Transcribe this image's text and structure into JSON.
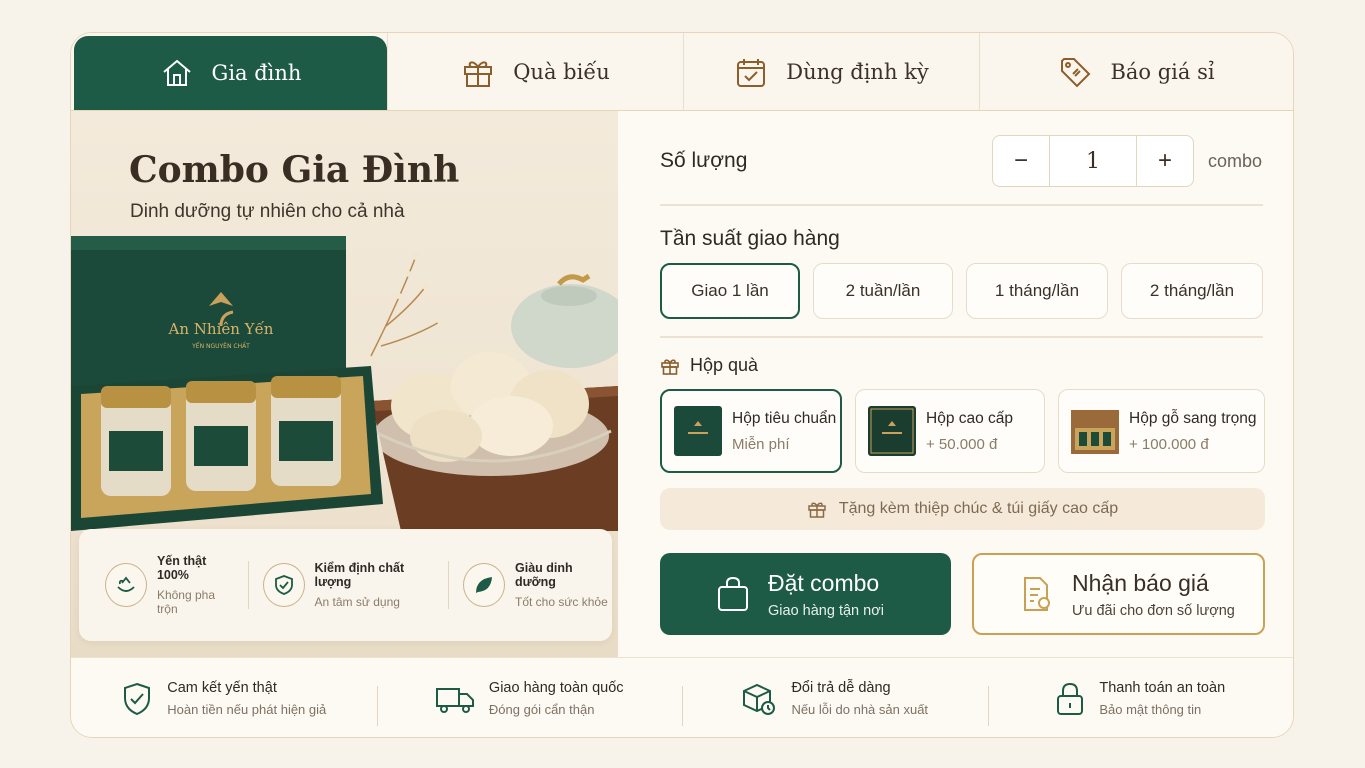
{
  "tabs": [
    {
      "label": "Gia đình",
      "icon": "home-icon",
      "active": true
    },
    {
      "label": "Quà biếu",
      "icon": "gift-icon",
      "active": false
    },
    {
      "label": "Dùng định kỳ",
      "icon": "calendar-icon",
      "active": false
    },
    {
      "label": "Báo giá sỉ",
      "icon": "price-tag-icon",
      "active": false
    }
  ],
  "hero": {
    "title": "Combo Gia Đình",
    "subtitle": "Dinh dưỡng tự nhiên cho cả nhà",
    "brand": "An Nhiên Yến",
    "brand_sub": "YẾN NGUYÊN CHẤT"
  },
  "features": [
    {
      "title": "Yến thật 100%",
      "desc": "Không pha trộn",
      "icon": "bird-nest-icon"
    },
    {
      "title": "Kiểm định chất lượng",
      "desc": "An tâm sử dụng",
      "icon": "shield-check-icon"
    },
    {
      "title": "Giàu dinh dưỡng",
      "desc": "Tốt cho sức khỏe",
      "icon": "leaf-icon"
    }
  ],
  "quantity": {
    "label": "Số lượng",
    "value": "1",
    "unit": "combo",
    "minus": "−",
    "plus": "+"
  },
  "frequency": {
    "label": "Tần suất giao hàng",
    "options": [
      "Giao 1 lần",
      "2 tuần/lần",
      "1 tháng/lần",
      "2 tháng/lần"
    ],
    "selected": "Giao 1 lần"
  },
  "gift_box": {
    "label": "Hộp quà",
    "options": [
      {
        "name": "Hộp tiêu chuẩn",
        "price": "Miễn phí"
      },
      {
        "name": "Hộp cao cấp",
        "price": "+ 50.000 đ"
      },
      {
        "name": "Hộp gỗ sang trọng",
        "price": "+ 100.000 đ"
      }
    ],
    "selected": "Hộp tiêu chuẩn",
    "note": "Tặng kèm thiệp chúc & túi giấy cao cấp"
  },
  "actions": {
    "order": {
      "title": "Đặt combo",
      "subtitle": "Giao hàng tận nơi"
    },
    "quote": {
      "title": "Nhận báo giá",
      "subtitle": "Ưu đãi cho đơn số lượng"
    }
  },
  "trust": [
    {
      "title": "Cam kết yến thật",
      "desc": "Hoàn tiền nếu phát hiện giả",
      "icon": "shield-check-icon"
    },
    {
      "title": "Giao hàng toàn quốc",
      "desc": "Đóng gói cẩn thận",
      "icon": "truck-icon"
    },
    {
      "title": "Đổi trả dễ dàng",
      "desc": "Nếu lỗi do nhà sản xuất",
      "icon": "box-return-icon"
    },
    {
      "title": "Thanh toán an toàn",
      "desc": "Bảo mật thông tin",
      "icon": "lock-icon"
    }
  ],
  "colors": {
    "primary": "#1d5b46",
    "accent": "#c9a155",
    "background": "#f8f3ea"
  }
}
